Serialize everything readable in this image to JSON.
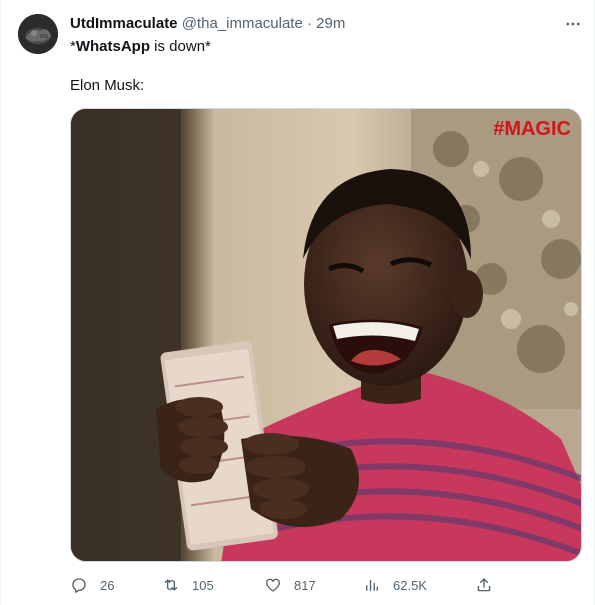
{
  "tweet": {
    "display_name": "UtdImmaculate",
    "handle": "@tha_immaculate",
    "separator": "·",
    "time": "29m",
    "text_line1_prefix": "*",
    "text_line1_bold": "WhatsApp",
    "text_line1_suffix": " is down*",
    "text_line2": "Elon Musk:",
    "media_watermark": "#MAGIC"
  },
  "actions": {
    "reply_count": "26",
    "retweet_count": "105",
    "like_count": "817",
    "views_count": "62.5K"
  },
  "icons": {
    "more": "more-horizontal-icon",
    "reply": "reply-icon",
    "retweet": "retweet-icon",
    "like": "heart-icon",
    "views": "analytics-icon",
    "share": "share-icon"
  },
  "colors": {
    "text_primary": "#0f1419",
    "text_secondary": "#536471",
    "border": "#cfd9de"
  }
}
